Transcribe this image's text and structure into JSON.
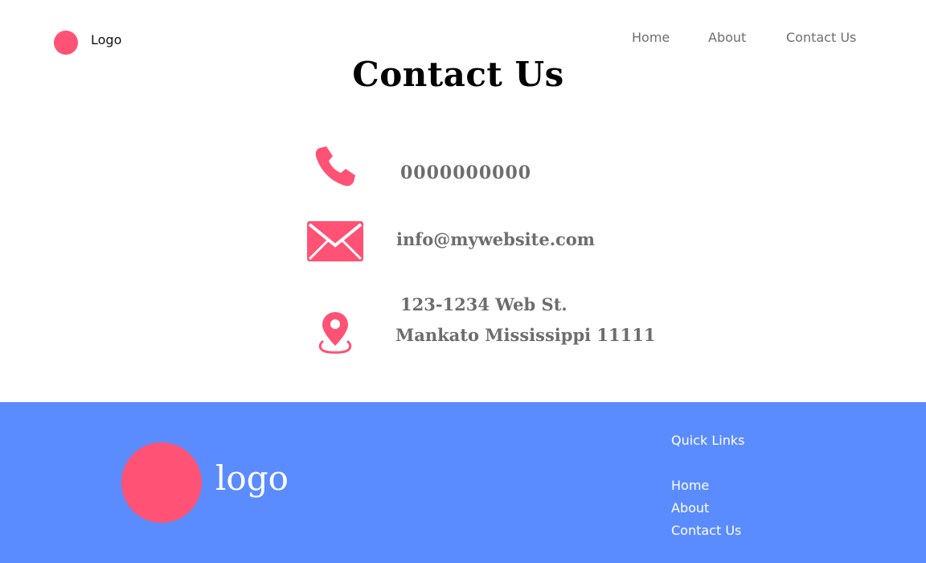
{
  "header": {
    "logo_label": "Logo",
    "nav": {
      "home": "Home",
      "about": "About",
      "contact": "Contact Us"
    }
  },
  "main": {
    "title": "Contact Us",
    "phone": "0000000000",
    "email": "info@mywebsite.com",
    "address_line1": "123-1234 Web St.",
    "address_line2": "Mankato Mississippi 11111"
  },
  "footer": {
    "logo_text": "logo",
    "quick_links_title": "Quick Links",
    "links": {
      "home": "Home",
      "about": "About",
      "contact": "Contact Us"
    }
  },
  "colors": {
    "accent": "#ff5274",
    "footer_bg": "#5b8cff",
    "text_gray": "#6d6d6d"
  },
  "icons": {
    "phone": "phone-icon",
    "mail": "mail-icon",
    "location": "location-pin-icon"
  }
}
